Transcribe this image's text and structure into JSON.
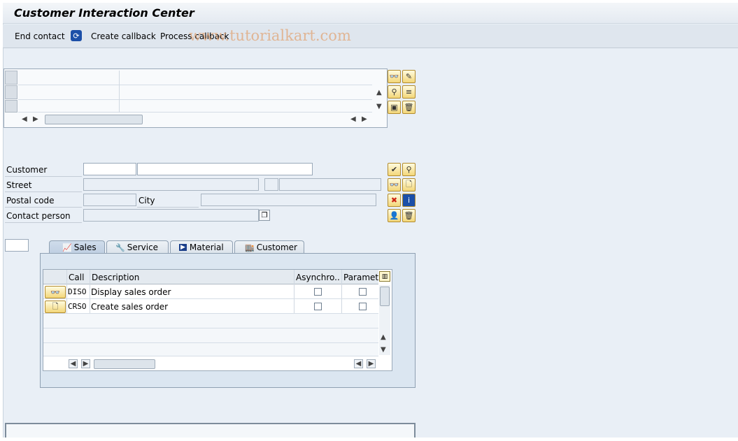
{
  "window": {
    "title": "Customer Interaction Center"
  },
  "toolbar": {
    "end_contact": "End contact",
    "create_callback": "Create callback",
    "process_callback": "Process callback"
  },
  "watermark": "www.tutorialkart.com",
  "address": {
    "customer_label": "Customer",
    "street_label": "Street",
    "postal_code_label": "Postal code",
    "city_label": "City",
    "contact_person_label": "Contact person"
  },
  "tabs": [
    {
      "label": "Sales",
      "icon": "chart-icon",
      "active": true
    },
    {
      "label": "Service",
      "icon": "tools-icon",
      "active": false
    },
    {
      "label": "Material",
      "icon": "play-icon",
      "active": false
    },
    {
      "label": "Customer",
      "icon": "customer-icon",
      "active": false
    }
  ],
  "grid": {
    "columns": [
      "Call",
      "Description",
      "Asynchro...",
      "Paramete"
    ],
    "rows": [
      {
        "call": "DISO",
        "description": "Display sales order",
        "icon": "glasses-icon",
        "async": false,
        "param": false
      },
      {
        "call": "CRSO",
        "description": "Create sales order",
        "icon": "document-icon",
        "async": false,
        "param": false
      }
    ]
  },
  "colors": {
    "background": "#e9eff6",
    "toolbar": "#dfe6ee",
    "tab_panel": "#dbe6f1",
    "icon_button": "#f3d779"
  }
}
